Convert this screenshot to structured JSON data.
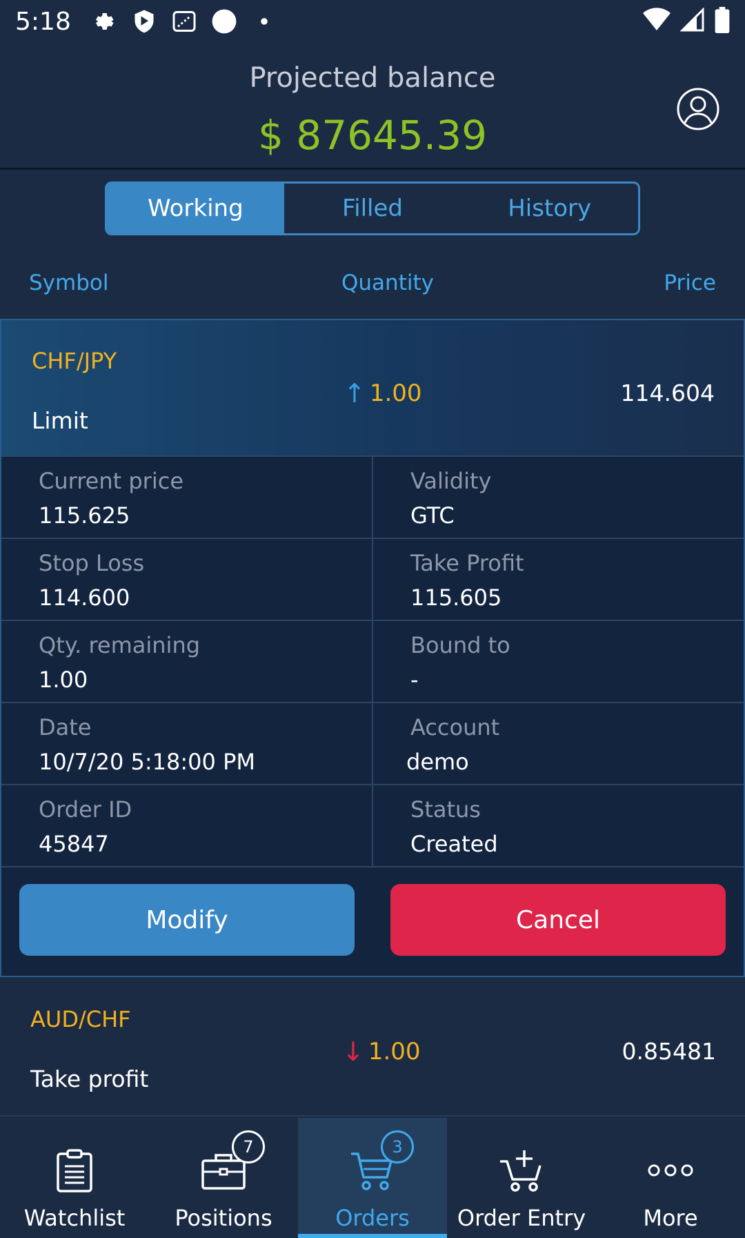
{
  "status_bar": {
    "time": "5:18",
    "icons_left": [
      "gear-icon",
      "shield-play-icon",
      "sparkle-box-icon",
      "circle-icon",
      "dot-icon"
    ],
    "icons_right": [
      "wifi-icon",
      "cell-signal-icon",
      "battery-icon"
    ]
  },
  "header": {
    "title": "Projected balance",
    "balance": "$ 87645.39",
    "profile_icon": "user-circle-icon",
    "balance_color": "#8ec325"
  },
  "tabs": [
    {
      "label": "Working",
      "active": true
    },
    {
      "label": "Filled",
      "active": false
    },
    {
      "label": "History",
      "active": false
    }
  ],
  "columns": {
    "symbol": "Symbol",
    "quantity": "Quantity",
    "price": "Price"
  },
  "orders": [
    {
      "symbol": "CHF/JPY",
      "type": "Limit",
      "direction": "up",
      "direction_glyph": "↑",
      "quantity": "1.00",
      "price": "114.604",
      "details": {
        "current_price": {
          "label": "Current price",
          "value": "115.625"
        },
        "validity": {
          "label": "Validity",
          "value": "GTC"
        },
        "stop_loss": {
          "label": "Stop Loss",
          "value": "114.600"
        },
        "take_profit": {
          "label": "Take Profit",
          "value": "115.605"
        },
        "qty_remaining": {
          "label": "Qty. remaining",
          "value": "1.00"
        },
        "bound_to": {
          "label": "Bound to",
          "value": "-"
        },
        "date": {
          "label": "Date",
          "value": "10/7/20 5:18:00 PM"
        },
        "account": {
          "label": "Account",
          "value": "demo"
        },
        "order_id": {
          "label": "Order ID",
          "value": "45847"
        },
        "status": {
          "label": "Status",
          "value": "Created"
        }
      },
      "actions": {
        "modify": "Modify",
        "cancel": "Cancel"
      }
    },
    {
      "symbol": "AUD/CHF",
      "type": "Take profit",
      "direction": "down",
      "direction_glyph": "↓",
      "quantity": "1.00",
      "price": "0.85481"
    }
  ],
  "bottom_nav": [
    {
      "label": "Watchlist",
      "icon": "clipboard-icon"
    },
    {
      "label": "Positions",
      "icon": "briefcase-icon",
      "badge": "7"
    },
    {
      "label": "Orders",
      "icon": "cart-icon",
      "badge": "3",
      "active": true
    },
    {
      "label": "Order Entry",
      "icon": "cart-add-icon"
    },
    {
      "label": "More",
      "icon": "more-dots-icon"
    }
  ],
  "colors": {
    "background": "#1c2b44",
    "accent": "#3a87c6",
    "link": "#41a9ec",
    "symbol": "#f2b21f",
    "cancel": "#e0254a",
    "up_arrow": "#3a9be0",
    "down_arrow": "#e0254a"
  }
}
